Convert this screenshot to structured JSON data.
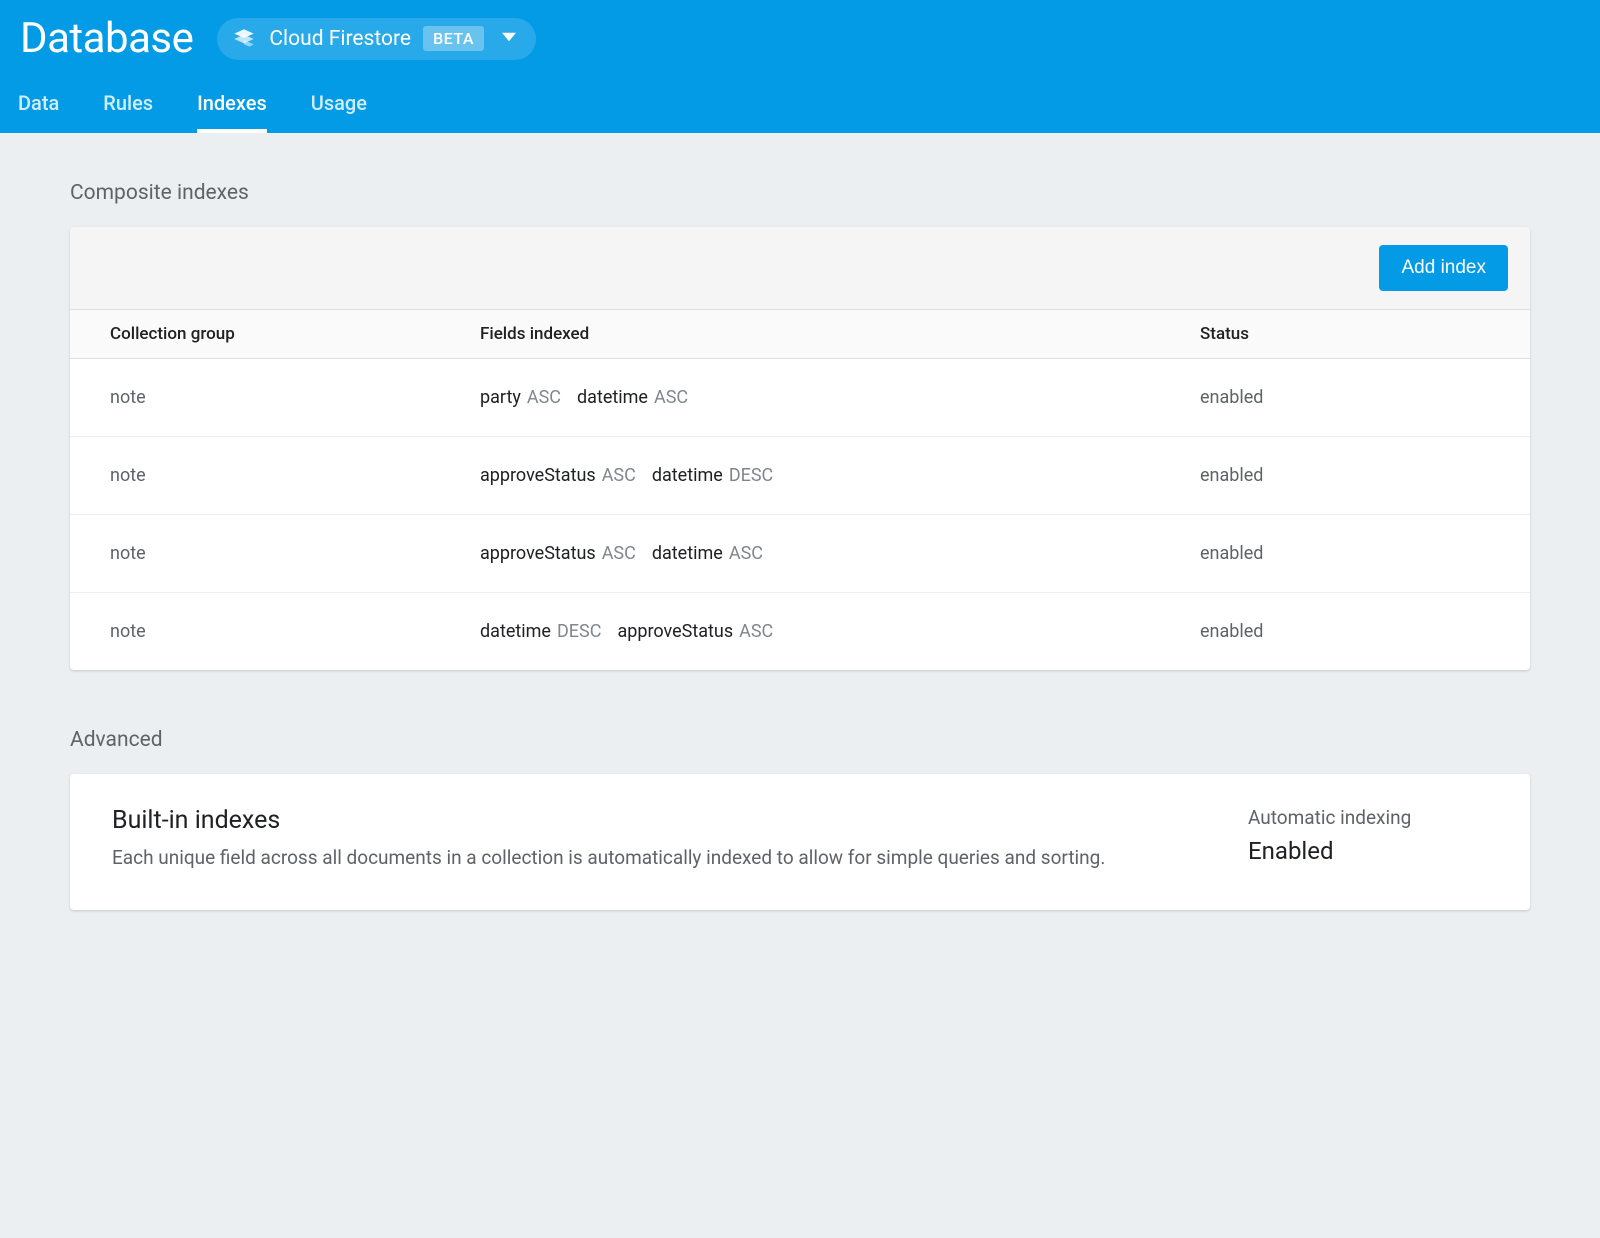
{
  "header": {
    "title": "Database",
    "selector_label": "Cloud Firestore",
    "selector_badge": "BETA"
  },
  "tabs": [
    {
      "label": "Data",
      "active": false
    },
    {
      "label": "Rules",
      "active": false
    },
    {
      "label": "Indexes",
      "active": true
    },
    {
      "label": "Usage",
      "active": false
    }
  ],
  "composite": {
    "section_title": "Composite indexes",
    "add_button": "Add index",
    "columns": {
      "group": "Collection group",
      "fields": "Fields indexed",
      "status": "Status"
    },
    "rows": [
      {
        "group": "note",
        "fields": [
          {
            "name": "party",
            "dir": "ASC"
          },
          {
            "name": "datetime",
            "dir": "ASC"
          }
        ],
        "status": "enabled"
      },
      {
        "group": "note",
        "fields": [
          {
            "name": "approveStatus",
            "dir": "ASC"
          },
          {
            "name": "datetime",
            "dir": "DESC"
          }
        ],
        "status": "enabled"
      },
      {
        "group": "note",
        "fields": [
          {
            "name": "approveStatus",
            "dir": "ASC"
          },
          {
            "name": "datetime",
            "dir": "ASC"
          }
        ],
        "status": "enabled"
      },
      {
        "group": "note",
        "fields": [
          {
            "name": "datetime",
            "dir": "DESC"
          },
          {
            "name": "approveStatus",
            "dir": "ASC"
          }
        ],
        "status": "enabled"
      }
    ]
  },
  "advanced": {
    "section_title": "Advanced",
    "card_title": "Built-in indexes",
    "card_desc": "Each unique field across all documents in a collection is automatically indexed to allow for simple queries and sorting.",
    "auto_label": "Automatic indexing",
    "auto_value": "Enabled"
  }
}
